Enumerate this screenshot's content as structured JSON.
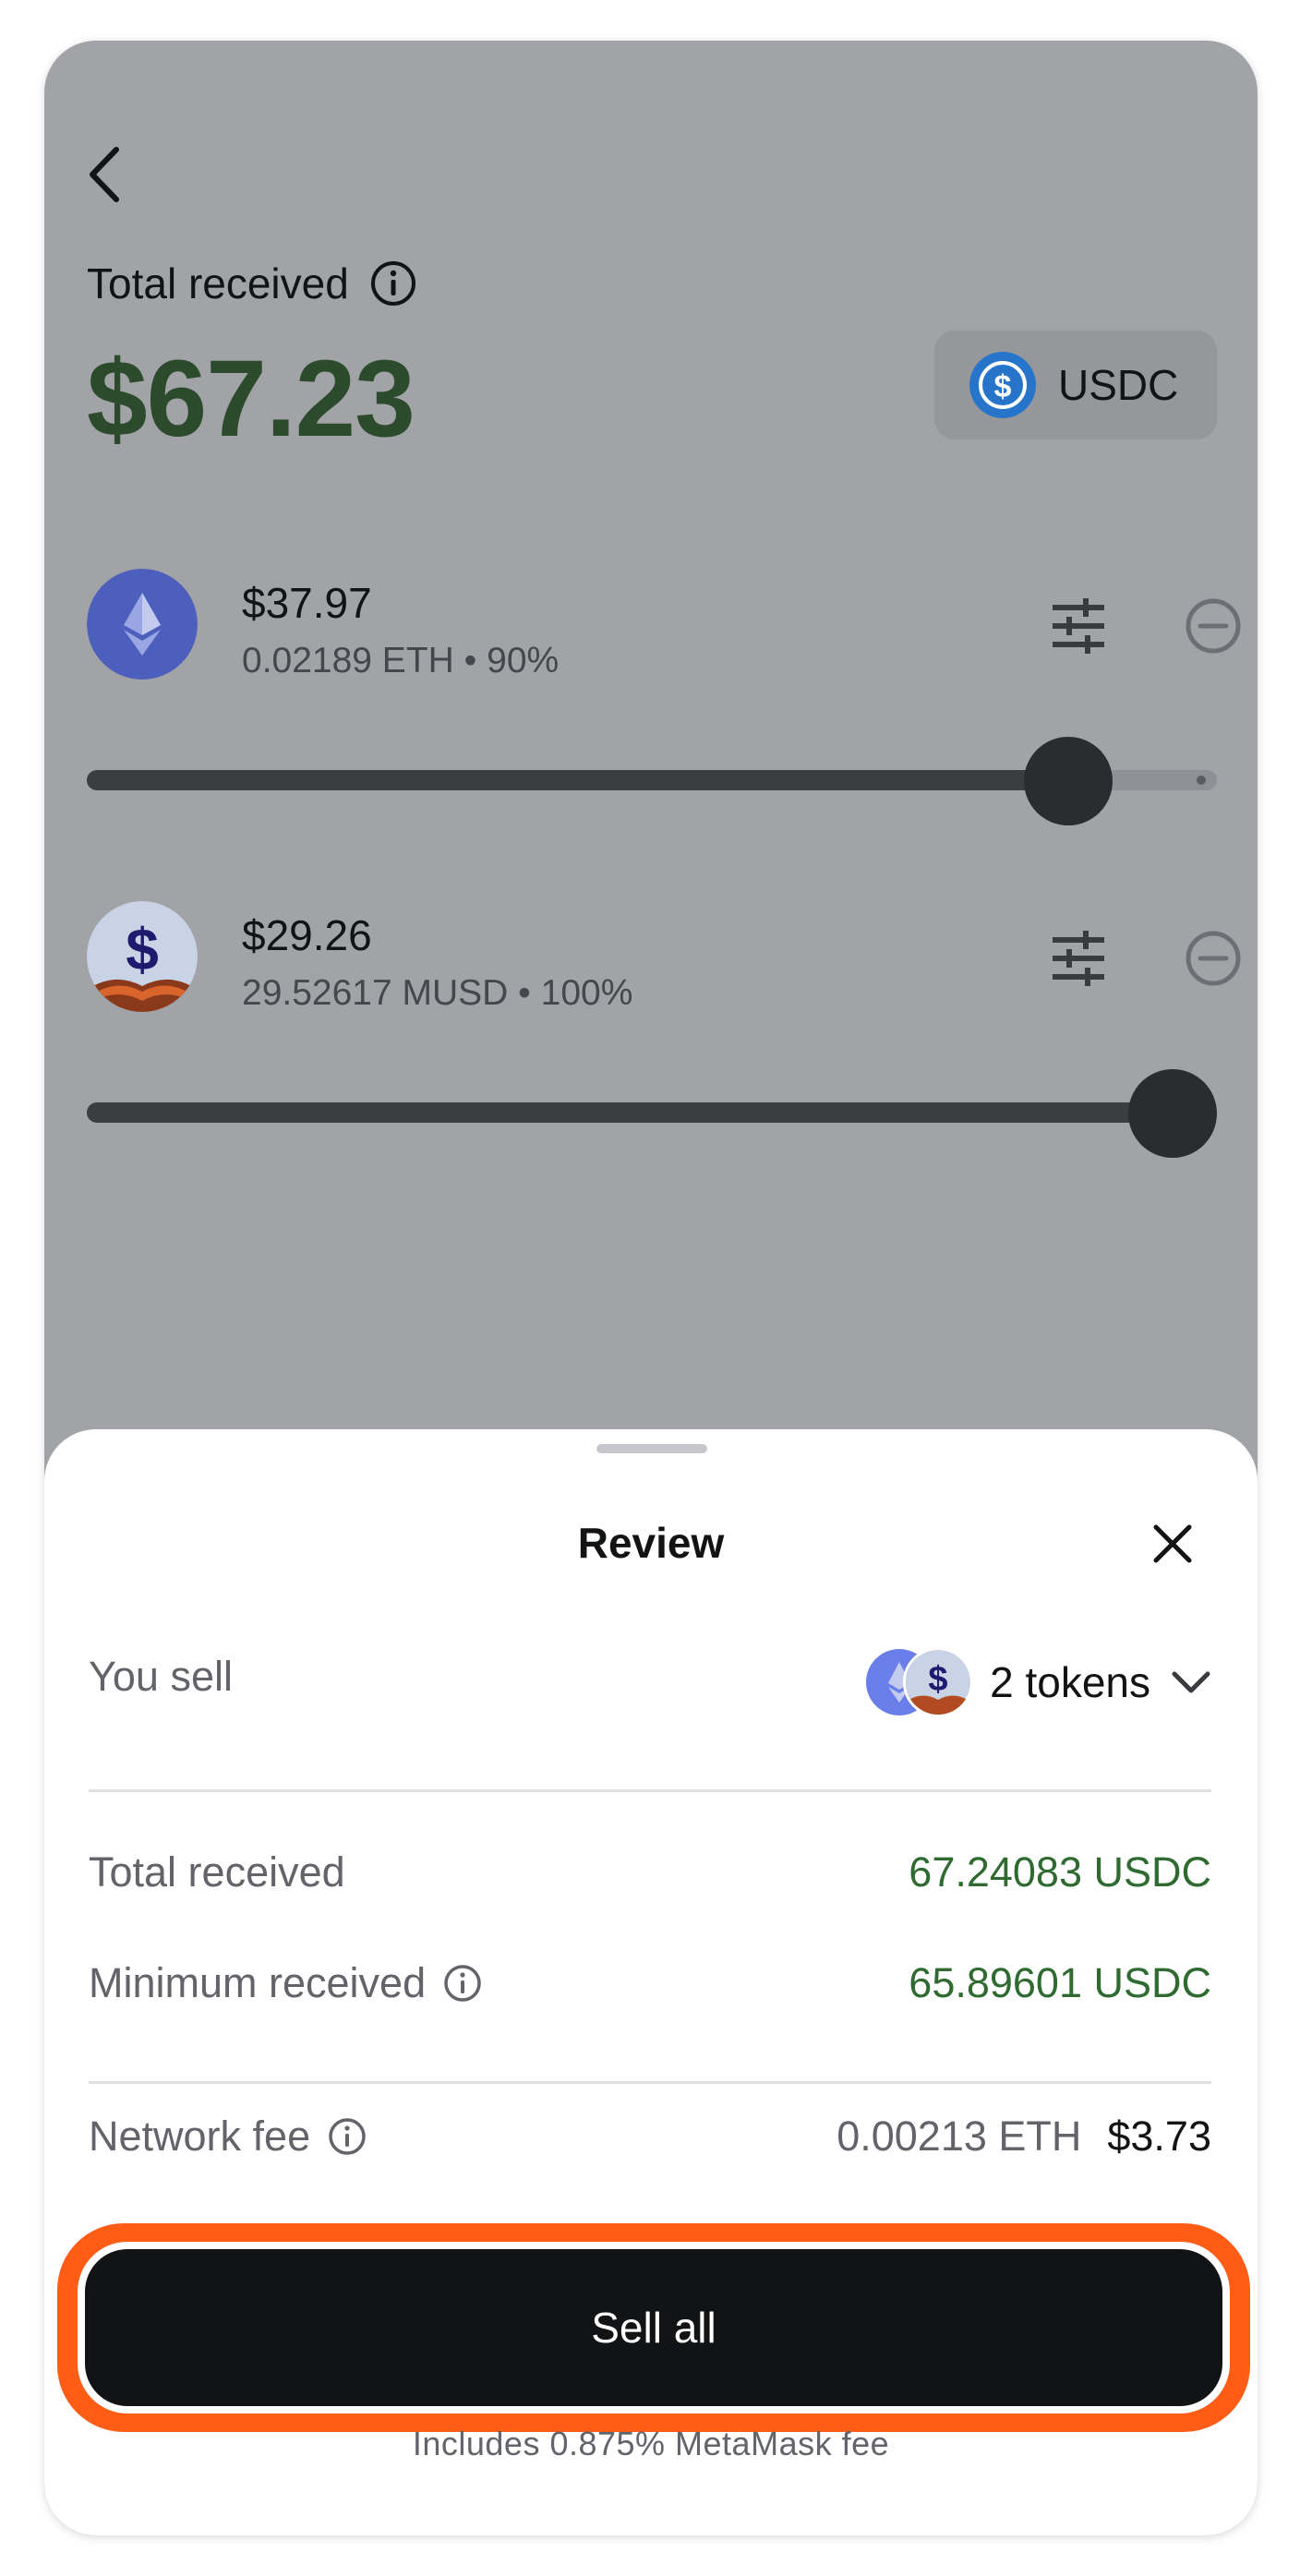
{
  "header": {
    "total_label": "Total received",
    "total_amount": "$67.23",
    "currency": "USDC"
  },
  "tokens": [
    {
      "value": "$37.97",
      "sub": "0.02189 ETH • 90%",
      "slider_fraction": 0.9
    },
    {
      "value": "$29.26",
      "sub": "29.52617 MUSD • 100%",
      "slider_fraction": 1.0
    }
  ],
  "sheet": {
    "title": "Review",
    "you_sell_label": "You sell",
    "tokens_count": "2 tokens",
    "total_received_label": "Total received",
    "total_received_value": "67.24083 USDC",
    "minimum_received_label": "Minimum received",
    "minimum_received_value": "65.89601 USDC",
    "network_fee_label": "Network fee",
    "network_fee_eth": "0.00213 ETH",
    "network_fee_usd": "$3.73",
    "sell_button": "Sell all",
    "fee_note": "Includes 0.875% MetaMask fee"
  },
  "colors": {
    "accent_green": "#2f6b30",
    "highlight": "#ff5c16",
    "button": "#121314"
  },
  "icons": [
    "back-arrow-icon",
    "info-icon",
    "usdc-icon",
    "eth-icon",
    "musd-icon",
    "sliders-icon",
    "minus-circle-icon",
    "close-icon",
    "chevron-down-icon"
  ]
}
